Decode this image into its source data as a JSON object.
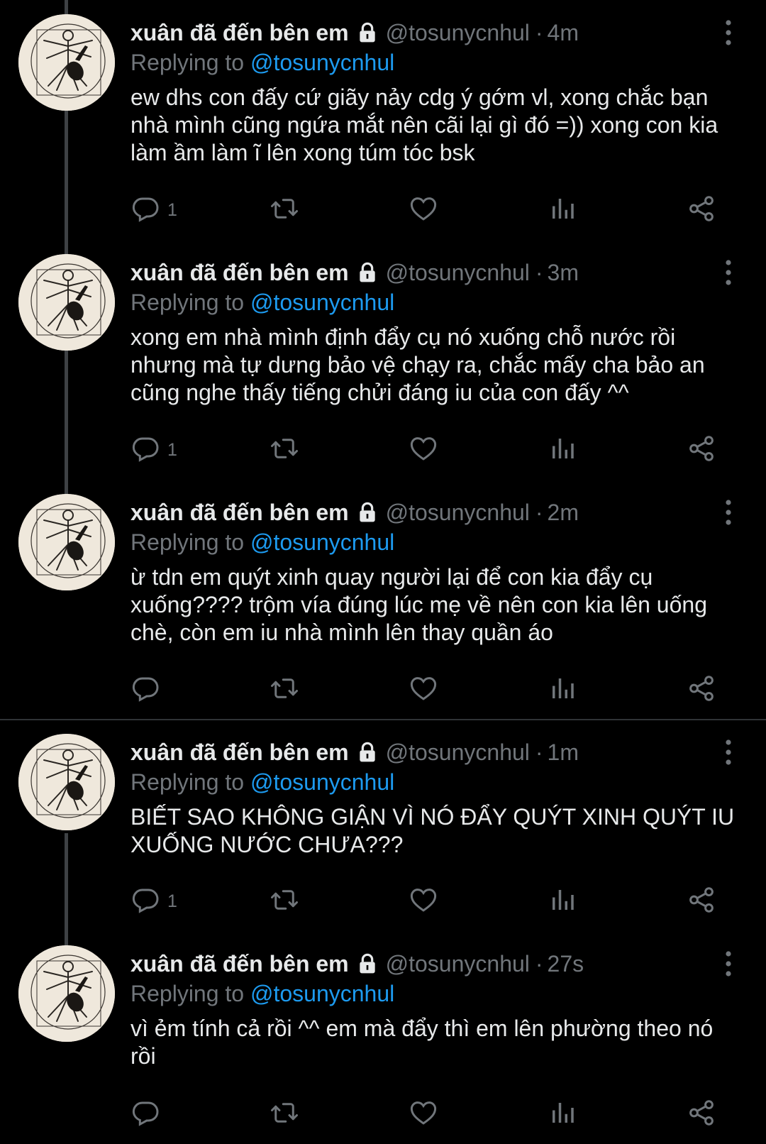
{
  "tweets": [
    {
      "name": "xuân đã đến bên em",
      "handle": "@tosunycnhul",
      "sep": "·",
      "time": "4m",
      "replying_prefix": "Replying to ",
      "replying_handle": "@tosunycnhul",
      "text": "ew dhs con đấy cứ giãy nảy cdg ý gớm vl, xong chắc bạn nhà mình cũng ngứa mắt nên cãi lại gì đó =)) xong con kia làm ầm làm ĩ lên xong túm tóc bsk",
      "reply_count": "1"
    },
    {
      "name": "xuân đã đến bên em",
      "handle": "@tosunycnhul",
      "sep": "·",
      "time": "3m",
      "replying_prefix": "Replying to ",
      "replying_handle": "@tosunycnhul",
      "text": "xong em nhà mình định đẩy cụ nó xuống chỗ nước rồi nhưng mà tự dưng bảo vệ chạy ra, chắc mấy cha bảo an cũng nghe thấy tiếng chửi đáng iu của con đấy ^^",
      "reply_count": "1"
    },
    {
      "name": "xuân đã đến bên em",
      "handle": "@tosunycnhul",
      "sep": "·",
      "time": "2m",
      "replying_prefix": "Replying to ",
      "replying_handle": "@tosunycnhul",
      "text": "ừ tdn em quýt xinh quay người lại để con kia đẩy cụ xuống???? trộm vía đúng lúc mẹ về nên con kia lên uống chè, còn em iu nhà mình lên thay quần áo",
      "reply_count": ""
    },
    {
      "name": "xuân đã đến bên em",
      "handle": "@tosunycnhul",
      "sep": "·",
      "time": "1m",
      "replying_prefix": "Replying to ",
      "replying_handle": "@tosunycnhul",
      "text": "BIẾT SAO KHÔNG GIẬN VÌ NÓ ĐẨY QUÝT XINH QUÝT IU XUỐNG NƯỚC CHƯA???",
      "reply_count": "1"
    },
    {
      "name": "xuân đã đến bên em",
      "handle": "@tosunycnhul",
      "sep": "·",
      "time": "27s",
      "replying_prefix": "Replying to ",
      "replying_handle": "@tosunycnhul",
      "text": "vì ẻm tính cả rồi ^^ em mà đẩy thì em lên phường theo nó rồi",
      "reply_count": ""
    }
  ]
}
